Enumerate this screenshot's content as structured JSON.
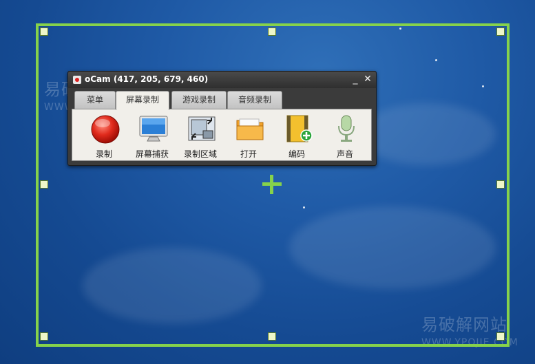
{
  "window": {
    "title": "oCam (417, 205, 679, 460)",
    "minimize_glyph": "_",
    "close_glyph": "✕"
  },
  "tabs": [
    {
      "label": "菜单",
      "active": false
    },
    {
      "label": "屏幕录制",
      "active": true
    },
    {
      "label": "游戏录制",
      "active": false
    },
    {
      "label": "音频录制",
      "active": false
    }
  ],
  "tools": [
    {
      "label": "录制",
      "icon": "record-icon"
    },
    {
      "label": "屏幕捕获",
      "icon": "monitor-icon"
    },
    {
      "label": "录制区域",
      "icon": "region-icon"
    },
    {
      "label": "打开",
      "icon": "folder-icon"
    },
    {
      "label": "编码",
      "icon": "codec-icon"
    },
    {
      "label": "声音",
      "icon": "microphone-icon"
    }
  ],
  "watermarks": {
    "cn": "易破解网站",
    "en": "WWW.YPOJIE.COM"
  },
  "colors": {
    "selection": "#86d24b",
    "handle_fill": "#eef7c9"
  }
}
